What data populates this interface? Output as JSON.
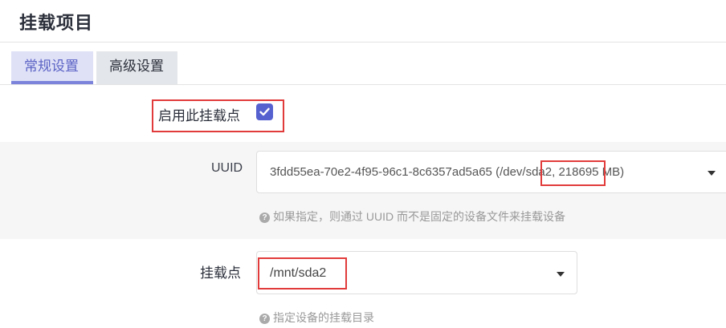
{
  "page": {
    "title": "挂载项目"
  },
  "tabs": [
    {
      "label": "常规设置",
      "active": true
    },
    {
      "label": "高级设置",
      "active": false
    }
  ],
  "enable": {
    "label": "启用此挂载点",
    "checked": true
  },
  "uuid": {
    "label": "UUID",
    "value_prefix": "3fdd55ea-70e2-4f95-96c1-8c6357ad5a65 (",
    "value_path": "/dev/sda2",
    "value_suffix": ", 218695 MB)",
    "help": "如果指定，则通过 UUID 而不是固定的设备文件来挂载设备"
  },
  "mount": {
    "label": "挂载点",
    "value": "/mnt/sda2",
    "help": "指定设备的挂载目录"
  },
  "colors": {
    "accent": "#5661d0",
    "highlight_box": "#e23b3b",
    "tab_active_bg": "#dfe1f7"
  },
  "icons": {
    "help": "question-circle-icon",
    "check": "check-icon",
    "dropdown": "caret-down-icon"
  }
}
